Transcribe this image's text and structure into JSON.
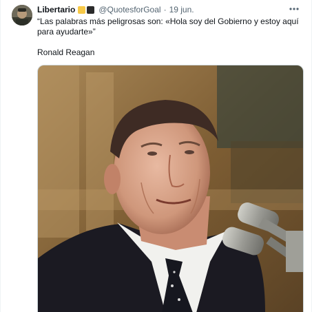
{
  "tweet": {
    "author": {
      "display_name": "Libertario",
      "flag_emoji_colors": [
        "#f7c948",
        "#2b2b2b"
      ],
      "handle": "@QuotesforGoal",
      "separator": "·",
      "date": "19 jun."
    },
    "more_icon": "more-horizontal-icon",
    "text_line1": "“Las palabras más peligrosas son: «Hola soy del Gobierno y estoy aquí para ayudarte»”",
    "text_line2": "Ronald Reagan",
    "media": {
      "icon": "photo",
      "accent_colors": {
        "background": "#8a6a3b",
        "suit": "#1b1a22",
        "skin": "#d9a48c"
      }
    }
  }
}
